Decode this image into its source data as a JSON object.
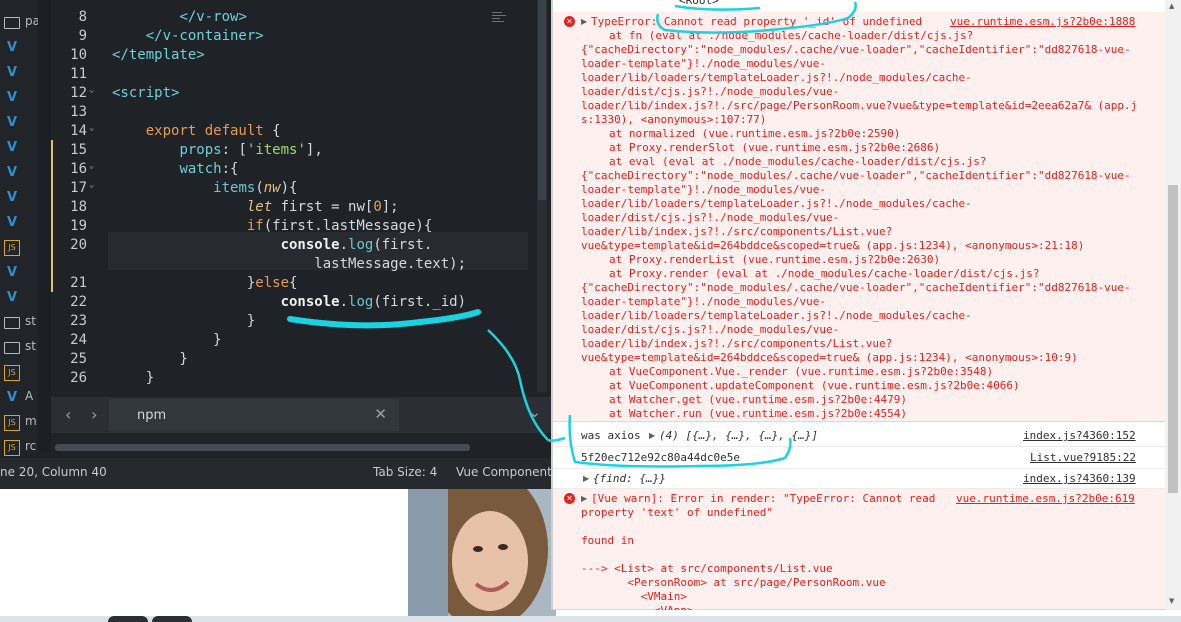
{
  "editor": {
    "sidebar": [
      {
        "type": "folder",
        "label": "pa"
      },
      {
        "type": "vue",
        "label": ""
      },
      {
        "type": "vue",
        "label": ""
      },
      {
        "type": "vue",
        "label": ""
      },
      {
        "type": "vue",
        "label": ""
      },
      {
        "type": "vue",
        "label": ""
      },
      {
        "type": "vue",
        "label": ""
      },
      {
        "type": "vue",
        "label": ""
      },
      {
        "type": "vue",
        "label": ""
      },
      {
        "type": "js",
        "label": ""
      },
      {
        "type": "vue",
        "label": ""
      },
      {
        "type": "vue",
        "label": ""
      },
      {
        "type": "folder",
        "label": "st"
      },
      {
        "type": "folder",
        "label": "st"
      },
      {
        "type": "js",
        "label": ""
      },
      {
        "type": "vue",
        "label": "A"
      },
      {
        "type": "js",
        "label": "m"
      },
      {
        "type": "js",
        "label": "rc"
      }
    ],
    "line_numbers": [
      "8",
      "9",
      "10",
      "11",
      "12",
      "13",
      "14",
      "15",
      "16",
      "17",
      "18",
      "19",
      "20",
      "",
      "21",
      "22",
      "23",
      "24",
      "25",
      "26"
    ],
    "code_lines": [
      {
        "parts": [
          [
            "",
            "        "
          ],
          [
            "tag",
            "</v-row>"
          ]
        ]
      },
      {
        "parts": [
          [
            "",
            "    "
          ],
          [
            "tag",
            "</v-container>"
          ]
        ]
      },
      {
        "parts": [
          [
            "tag",
            "</template>"
          ]
        ]
      },
      {
        "parts": [
          [
            "",
            ""
          ]
        ]
      },
      {
        "parts": [
          [
            "tag",
            "<script>"
          ]
        ]
      },
      {
        "parts": [
          [
            "",
            ""
          ]
        ]
      },
      {
        "parts": [
          [
            "",
            "    "
          ],
          [
            "kw",
            "export default"
          ],
          [
            "",
            " {"
          ]
        ]
      },
      {
        "parts": [
          [
            "",
            "        "
          ],
          [
            "prop",
            "props"
          ],
          [
            "",
            ": ["
          ],
          [
            "str",
            "'items'"
          ],
          [
            "",
            "],"
          ]
        ]
      },
      {
        "parts": [
          [
            "",
            "        "
          ],
          [
            "prop",
            "watch"
          ],
          [
            "",
            ":{"
          ]
        ]
      },
      {
        "parts": [
          [
            "",
            "            "
          ],
          [
            "fn",
            "items"
          ],
          [
            "",
            "("
          ],
          [
            "it",
            "nw"
          ],
          [
            "",
            "){"
          ]
        ]
      },
      {
        "parts": [
          [
            "",
            "                "
          ],
          [
            "it",
            "let"
          ],
          [
            "",
            " first = nw["
          ],
          [
            "num",
            "0"
          ],
          [
            "",
            "];"
          ]
        ]
      },
      {
        "parts": [
          [
            "",
            "                "
          ],
          [
            "kw",
            "if"
          ],
          [
            "",
            "(first.lastMessage){"
          ]
        ]
      },
      {
        "parts": [
          [
            "",
            "                    "
          ],
          [
            "cons",
            "console"
          ],
          [
            "",
            "."
          ],
          [
            "fn",
            "log"
          ],
          [
            "",
            "(first."
          ]
        ]
      },
      {
        "parts": [
          [
            "",
            "                        lastMessage.text);"
          ]
        ]
      },
      {
        "parts": [
          [
            "",
            "                }"
          ],
          [
            "kw",
            "else"
          ],
          [
            "",
            "{"
          ]
        ]
      },
      {
        "parts": [
          [
            "",
            "                    "
          ],
          [
            "cons",
            "console"
          ],
          [
            "",
            "."
          ],
          [
            "fn",
            "log"
          ],
          [
            "",
            "(first._id)"
          ]
        ]
      },
      {
        "parts": [
          [
            "",
            "                }"
          ]
        ]
      },
      {
        "parts": [
          [
            "",
            "            }"
          ]
        ]
      },
      {
        "parts": [
          [
            "",
            "        }"
          ]
        ]
      },
      {
        "parts": [
          [
            "",
            "    }"
          ]
        ]
      }
    ],
    "panel": {
      "tab_label": "npm",
      "close": "✕",
      "prev": "‹",
      "next": "›",
      "toggle": "⌄"
    },
    "status": {
      "position": "ne 20, Column 40",
      "tab_size": "Tab Size: 4",
      "syntax": "Vue Component"
    }
  },
  "console": {
    "top_text": "<Root>",
    "error1": {
      "header": "TypeError: Cannot read property '_id' of undefined",
      "header_src": "vue.runtime.esm.js?2b0e:1888",
      "lines": [
        "at fn (eval at ./node_modules/cache-loader/dist/cjs.js?",
        "{\"cacheDirectory\":\"node_modules/.cache/vue-loader\",\"cacheIdentifier\":\"dd827618-vue-",
        "loader-template\"}!./node_modules/vue-",
        "loader/lib/loaders/templateLoader.js?!./node_modules/cache-",
        "loader/dist/cjs.js?!./node_modules/vue-",
        "loader/lib/index.js?!./src/page/PersonRoom.vue?vue&type=template&id=2eea62a7& (app.j",
        "s:1330), <anonymous>:107:77)",
        "at normalized (vue.runtime.esm.js?2b0e:2590)",
        "at Proxy.renderSlot (vue.runtime.esm.js?2b0e:2686)",
        "at eval (eval at ./node_modules/cache-loader/dist/cjs.js?",
        "{\"cacheDirectory\":\"node_modules/.cache/vue-loader\",\"cacheIdentifier\":\"dd827618-vue-",
        "loader-template\"}!./node_modules/vue-",
        "loader/lib/loaders/templateLoader.js?!./node_modules/cache-",
        "loader/dist/cjs.js?!./node_modules/vue-",
        "loader/lib/index.js?!./src/components/List.vue?",
        "vue&type=template&id=264bddce&scoped=true& (app.js:1234), <anonymous>:21:18)",
        "at Proxy.renderList (vue.runtime.esm.js?2b0e:2630)",
        "at Proxy.render (eval at ./node_modules/cache-loader/dist/cjs.js?",
        "{\"cacheDirectory\":\"node_modules/.cache/vue-loader\",\"cacheIdentifier\":\"dd827618-vue-",
        "loader-template\"}!./node_modules/vue-",
        "loader/lib/loaders/templateLoader.js?!./node_modules/cache-",
        "loader/dist/cjs.js?!./node_modules/vue-",
        "loader/lib/index.js?!./src/components/List.vue?",
        "vue&type=template&id=264bddce&scoped=true& (app.js:1234), <anonymous>:10:9)",
        "at VueComponent.Vue._render (vue.runtime.esm.js?2b0e:3548)",
        "at VueComponent.updateComponent (vue.runtime.esm.js?2b0e:4066)",
        "at Watcher.get (vue.runtime.esm.js?2b0e:4479)",
        "at Watcher.run (vue.runtime.esm.js?2b0e:4554)"
      ]
    },
    "log1": {
      "prefix": "was axios",
      "value": "(4) [{…}, {…}, {…}, {…}]",
      "src": "index.js?4360:152"
    },
    "log2": {
      "value": "5f20ec712e92c80a44dc0e5e",
      "src": "List.vue?9185:22"
    },
    "log3": {
      "value": "{find: {…}}",
      "src": "index.js?4360:139"
    },
    "error2": {
      "header": "[Vue warn]: Error in render: \"TypeError: Cannot read",
      "header_src": "vue.runtime.esm.js?2b0e:619",
      "lines": [
        "property 'text' of undefined\"",
        "",
        "found in",
        "",
        "---> <List> at src/components/List.vue",
        "       <PersonRoom> at src/page/PersonRoom.vue",
        "         <VMain>",
        "           <VApp>"
      ]
    }
  },
  "colors": {
    "annotation": "#19d3e0",
    "error_bg": "#fff0f0",
    "error_text": "#e0231e",
    "editor_bg": "#1f2327"
  }
}
